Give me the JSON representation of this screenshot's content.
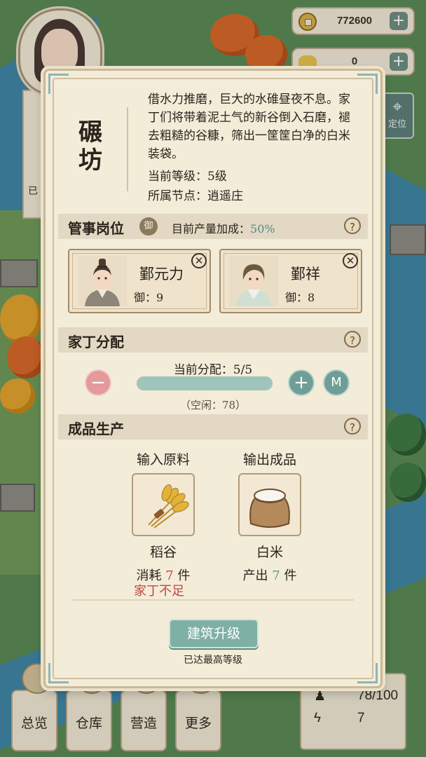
{
  "resources": {
    "coins": {
      "value": "772600",
      "icon": "coin-icon"
    },
    "ingots": {
      "value": "0",
      "icon": "gold-ingot-icon"
    }
  },
  "hud": {
    "locate_label": "定位",
    "avatar_side_text": "已"
  },
  "building": {
    "name": "碾坊",
    "description": "借水力推磨，巨大的水碓昼夜不息。家丁们将带着泥土气的新谷倒入石磨，褪去粗糙的谷糠，筛出一筐筐白净的白米装袋。",
    "level_line": "当前等级：5级",
    "node_line": "所属节点：逍遥庄"
  },
  "managers": {
    "title": "管事岗位",
    "badge": "御",
    "bonus_label": "目前产量加成：",
    "bonus_value": "50%",
    "items": [
      {
        "name": "鄞元力",
        "stat": "御：9"
      },
      {
        "name": "鄞祥",
        "stat": "御：8"
      }
    ]
  },
  "workers": {
    "title": "家丁分配",
    "current_label": "当前分配：5/5",
    "assigned": 5,
    "capacity": 5,
    "idle_label": "（空闲：78）",
    "max_label": "M"
  },
  "production": {
    "title": "成品生产",
    "input_header": "输入原料",
    "output_header": "输出成品",
    "input": {
      "name": "稻谷",
      "qty_prefix": "消耗",
      "qty": "7",
      "qty_suffix": "件",
      "icon": "rice-sheaf-icon"
    },
    "output": {
      "name": "白米",
      "qty_prefix": "产出",
      "qty": "7",
      "qty_suffix": "件",
      "icon": "rice-sack-icon"
    },
    "warning": "家丁不足"
  },
  "upgrade": {
    "button_label": "建筑升级",
    "status": "已达最高等级"
  },
  "nav": {
    "items": [
      {
        "label": "总览"
      },
      {
        "label": "仓库"
      },
      {
        "label": "营造"
      },
      {
        "label": "更多"
      }
    ]
  },
  "stats": {
    "population": "78/100",
    "energy": "7"
  },
  "colors": {
    "accent_teal": "#7fb0a6",
    "warning_red": "#c7443e",
    "bonus_teal": "#4f8c86",
    "panel_bg": "#f3ecd9"
  }
}
